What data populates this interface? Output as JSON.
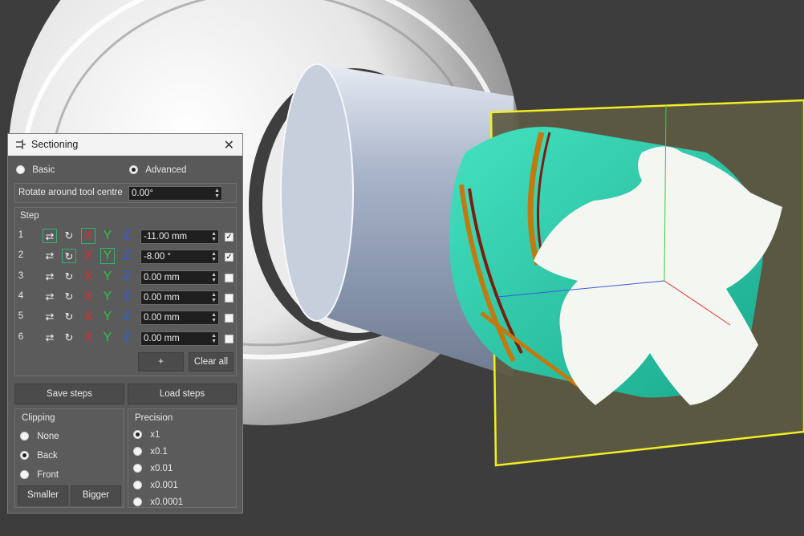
{
  "panel": {
    "title": "Sectioning",
    "modes": {
      "basic": "Basic",
      "advanced": "Advanced",
      "selected": "advanced"
    },
    "rotate": {
      "label": "Rotate around tool centre",
      "value": "0.00°"
    },
    "step_header": "Step",
    "steps": [
      {
        "num": "1",
        "value": "-11.00 mm",
        "checked": true
      },
      {
        "num": "2",
        "value": "-8.00 °",
        "checked": true
      },
      {
        "num": "3",
        "value": "0.00 mm",
        "checked": false
      },
      {
        "num": "4",
        "value": "0.00 mm",
        "checked": false
      },
      {
        "num": "5",
        "value": "0.00 mm",
        "checked": false
      },
      {
        "num": "6",
        "value": "0.00 mm",
        "checked": false
      }
    ],
    "icons": {
      "swap": "⇄",
      "rotate": "↻",
      "x": "X",
      "y": "Y",
      "z": "Z"
    },
    "add_button": "+",
    "clear_all_button": "Clear all",
    "save_steps": "Save steps",
    "load_steps": "Load steps",
    "clipping": {
      "label": "Clipping",
      "options": [
        "None",
        "Back",
        "Front"
      ],
      "selected": "Back"
    },
    "precision": {
      "label": "Precision",
      "options": [
        "x1",
        "x0.1",
        "x0.01",
        "x0.001",
        "x0.0001"
      ],
      "selected": "x1"
    },
    "smaller_button": "Smaller",
    "bigger_button": "Bigger",
    "colors": {
      "axis_x": "#e02b2b",
      "axis_y": "#2fc23f",
      "axis_z": "#2f5ee0",
      "selection": "#2fb56b"
    }
  }
}
